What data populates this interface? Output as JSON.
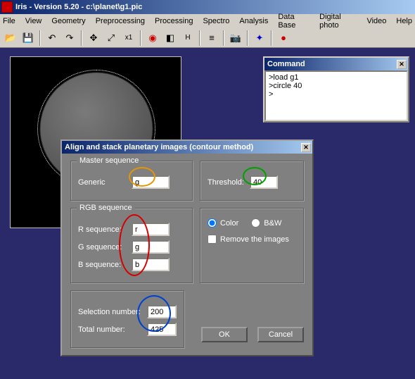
{
  "title": "Iris - Version 5.20 - c:\\planet\\g1.pic",
  "menu": [
    "File",
    "View",
    "Geometry",
    "Preprocessing",
    "Processing",
    "Spectro",
    "Analysis",
    "Data Base",
    "Digital photo",
    "Video",
    "Help"
  ],
  "toolbar_icons": [
    "open",
    "save",
    "undo",
    "redo",
    "move",
    "zoom-in",
    "x1",
    "swirl",
    "tone",
    "histogram",
    "levels",
    "camera",
    "blue-dot",
    "red-dot"
  ],
  "cmd": {
    "title": "Command",
    "lines": ">load g1\n>circle 40\n>"
  },
  "dialog": {
    "title": "Align and stack planetary images (contour method)",
    "master": {
      "legend": "Master sequence",
      "generic_label": "Generic",
      "generic": "g"
    },
    "rgb": {
      "legend": "RGB sequence",
      "r_label": "R sequence:",
      "r": "r",
      "g_label": "G sequence:",
      "g": "g",
      "b_label": "B sequence:",
      "b": "b"
    },
    "threshold_label": "Threshold:",
    "threshold": "40",
    "color_label": "Color",
    "bw_label": "B&W",
    "remove_label": "Remove the images",
    "sel_label": "Selection number:",
    "sel": "200",
    "tot_label": "Total number:",
    "tot": "425",
    "ok": "OK",
    "cancel": "Cancel"
  }
}
